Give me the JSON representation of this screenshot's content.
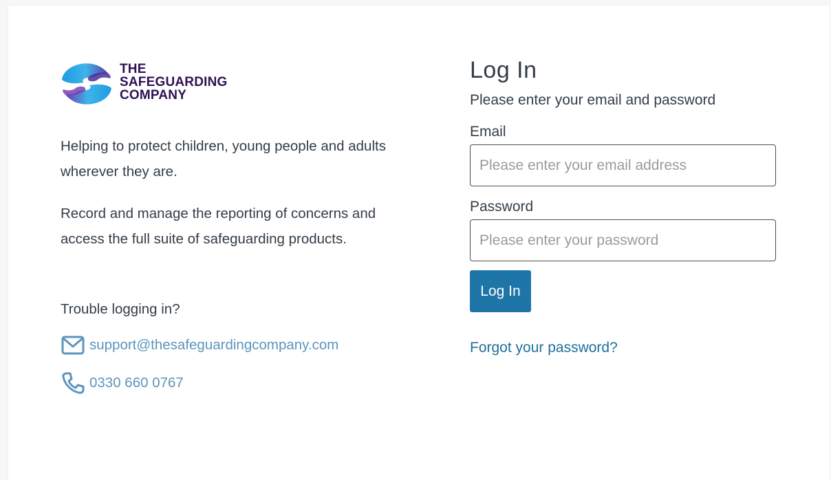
{
  "brand": {
    "lines": [
      "THE",
      "SAFEGUARDING",
      "COMPANY"
    ],
    "colors": {
      "text": "#2d1252",
      "blue": "#29a3e0",
      "purple": "#6b3fa0"
    }
  },
  "intro": {
    "paragraph_1": "Helping to protect children, young people and adults wherever they are.",
    "paragraph_2": "Record and manage the reporting of concerns and access the full suite of safeguarding products."
  },
  "support": {
    "heading": "Trouble logging in?",
    "email": "support@thesafeguardingcompany.com",
    "email_icon": "mail-icon",
    "phone": "0330 660 0767",
    "phone_icon": "phone-icon",
    "link_color": "#5b95bd"
  },
  "login": {
    "title": "Log In",
    "subtitle": "Please enter your email and password",
    "email_label": "Email",
    "email_value": "",
    "email_placeholder": "Please enter your email address",
    "password_label": "Password",
    "password_value": "",
    "password_placeholder": "Please enter your password",
    "button_label": "Log In",
    "button_color": "#1e76a8",
    "forgot_label": "Forgot your password?"
  }
}
